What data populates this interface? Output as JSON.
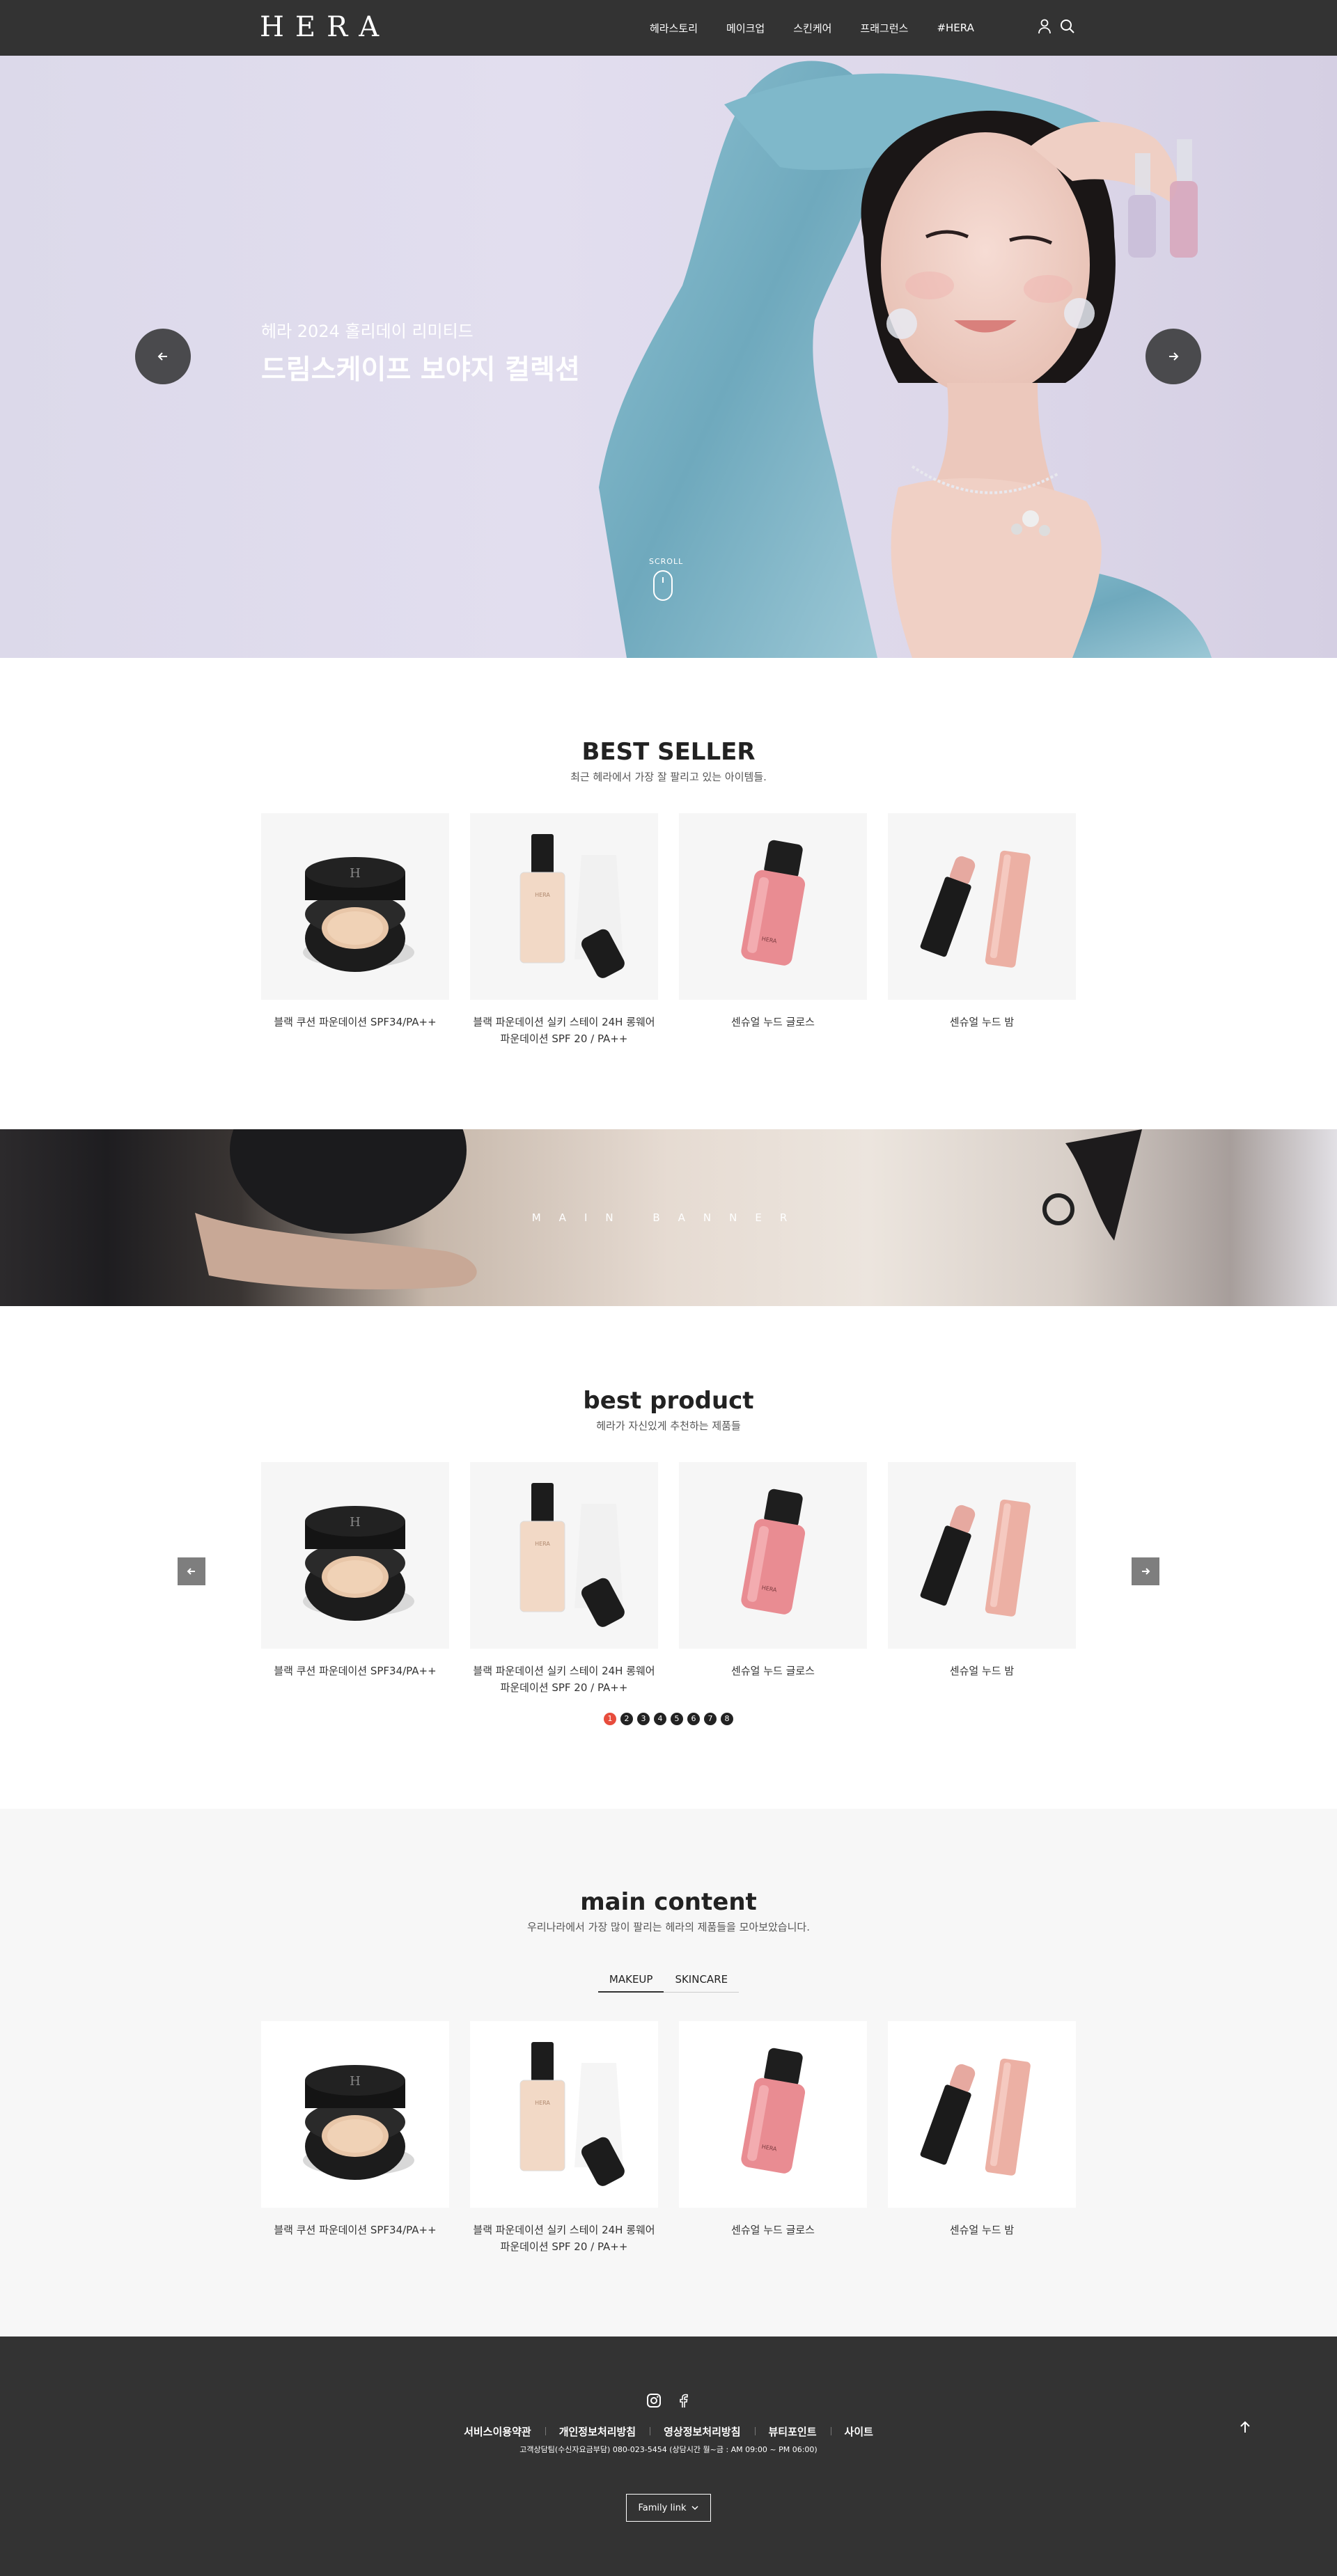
{
  "header": {
    "logo": "HERA",
    "nav": [
      "헤라스토리",
      "메이크업",
      "스킨케어",
      "프래그런스",
      "#HERA"
    ],
    "icons": [
      "user-icon",
      "search-icon"
    ]
  },
  "hero": {
    "subtitle": "헤라 2024 홀리데이 리미티드",
    "title": "드림스케이프 보야지 컬렉션",
    "scroll_label": "SCROLL"
  },
  "best_seller": {
    "title": "BEST SELLER",
    "desc": "최근 헤라에서 가장 잘 팔리고 있는 아이템들.",
    "products": [
      {
        "name": "블랙 쿠션 파운데이션 SPF34/PA++",
        "icon": "cushion-compact"
      },
      {
        "name": "블랙 파운데이션 실키 스테이 24H 롱웨어 파운데이션 SPF 20 / PA++",
        "icon": "foundation-bottle"
      },
      {
        "name": "센슈얼 누드 글로스",
        "icon": "lip-gloss"
      },
      {
        "name": "센슈얼 누드 밤",
        "icon": "lip-balm"
      }
    ]
  },
  "main_banner": {
    "text": "MAIN BANNER"
  },
  "best_product": {
    "title": "best product",
    "desc": "헤라가 자신있게 추천하는 제품들",
    "products": [
      {
        "name": "블랙 쿠션 파운데이션 SPF34/PA++"
      },
      {
        "name": "블랙 파운데이션 실키 스테이 24H 롱웨어 파운데이션 SPF 20 / PA++"
      },
      {
        "name": "센슈얼 누드 글로스"
      },
      {
        "name": "센슈얼 누드 밤"
      }
    ],
    "pages": [
      "1",
      "2",
      "3",
      "4",
      "5",
      "6",
      "7",
      "8"
    ],
    "active_page": "1"
  },
  "main_content": {
    "title": "main content",
    "desc": "우리나라에서 가장 많이 팔리는 헤라의 제품들을 모아보았습니다.",
    "tabs": [
      "MAKEUP",
      "SKINCARE"
    ],
    "active_tab": "MAKEUP",
    "products": [
      {
        "name": "블랙 쿠션 파운데이션 SPF34/PA++"
      },
      {
        "name": "블랙 파운데이션 실키 스테이 24H 롱웨어 파운데이션 SPF 20 / PA++"
      },
      {
        "name": "센슈얼 누드 글로스"
      },
      {
        "name": "센슈얼 누드 밤"
      }
    ]
  },
  "footer": {
    "social": [
      "instagram-icon",
      "facebook-icon"
    ],
    "links": [
      "서비스이용약관",
      "개인정보처리방침",
      "영상정보처리방침",
      "뷰티포인트",
      "사이트"
    ],
    "info": "고객상담팀(수신자요금부담) 080-023-5454 (상담시간 월~금 : AM 09:00 ~ PM 06:00)",
    "family_link": "Family link"
  },
  "colors": {
    "header_bg": "#333333",
    "footer_bg": "#333333",
    "accent_dot": "#e74c3c",
    "gloss_pink": "#e98c92",
    "balm_nude": "#ecb0a4"
  }
}
